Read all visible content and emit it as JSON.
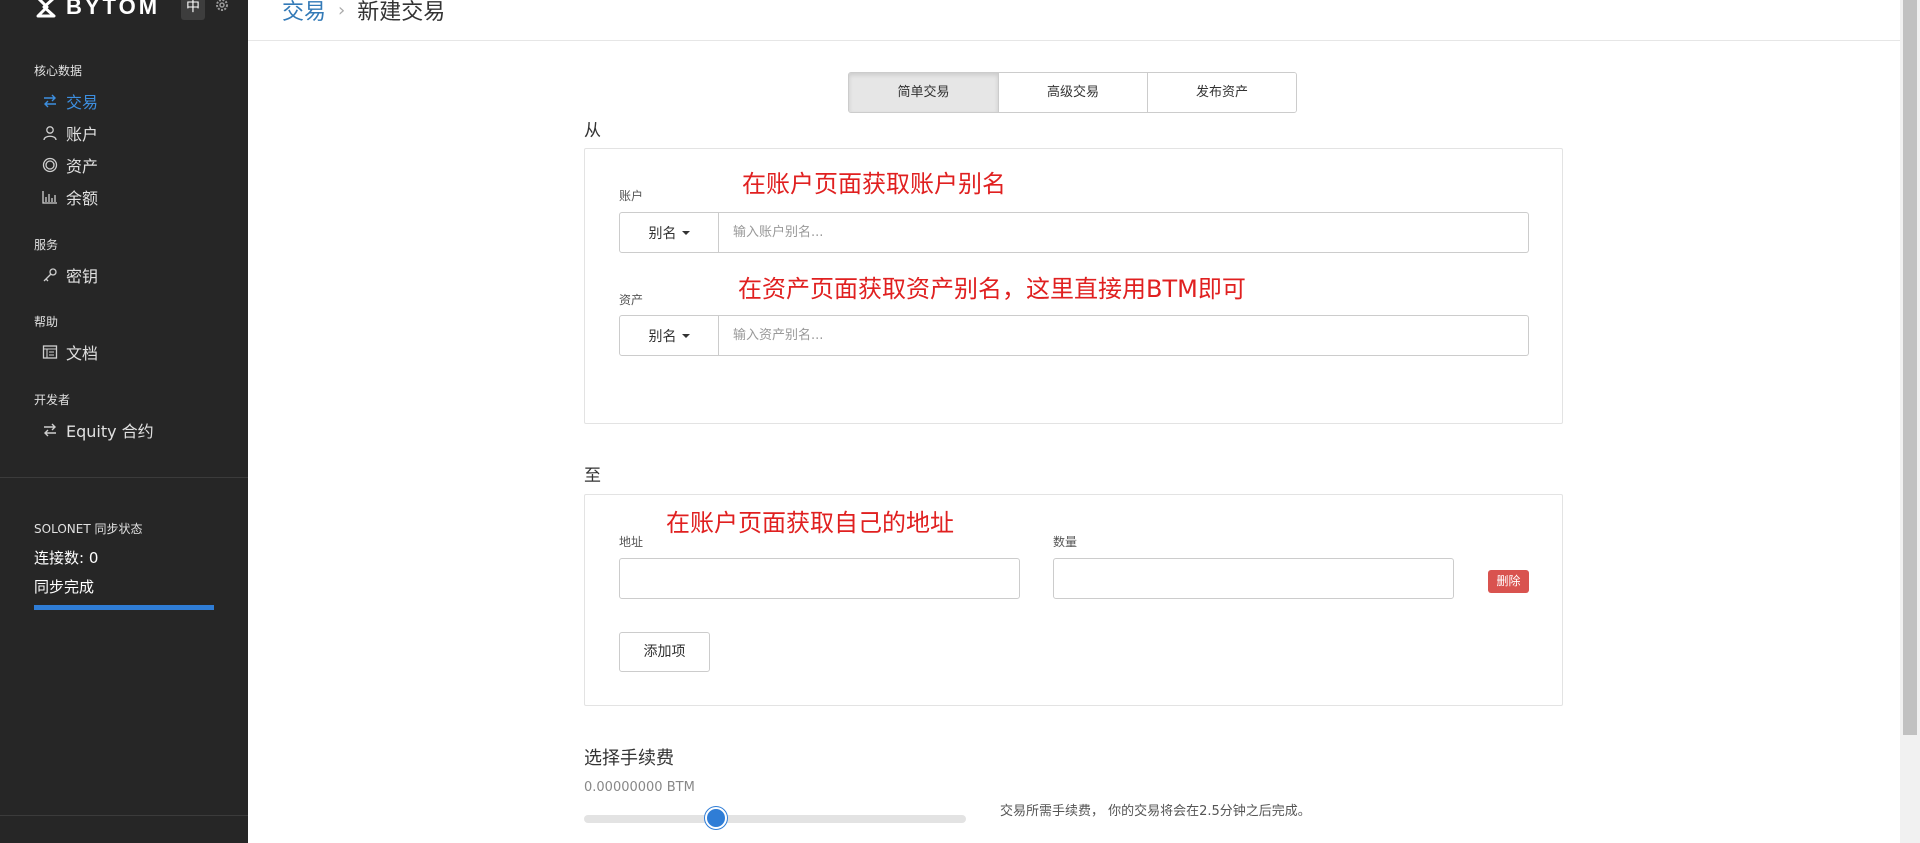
{
  "brand": {
    "name": "BYTOM",
    "lang_button": "中",
    "accent": "#3d8fe0"
  },
  "sidebar": {
    "groups": [
      {
        "title": "核心数据",
        "items": [
          {
            "label": "交易",
            "icon": "transfer-icon",
            "active": true
          },
          {
            "label": "账户",
            "icon": "user-icon"
          },
          {
            "label": "资产",
            "icon": "circle-icon"
          },
          {
            "label": "余额",
            "icon": "bar-chart-icon"
          }
        ]
      },
      {
        "title": "服务",
        "items": [
          {
            "label": "密钥",
            "icon": "key-icon"
          }
        ]
      },
      {
        "title": "帮助",
        "items": [
          {
            "label": "文档",
            "icon": "document-icon"
          }
        ]
      },
      {
        "title": "开发者",
        "items": [
          {
            "label": "Equity 合约",
            "icon": "transfer-icon"
          }
        ]
      }
    ],
    "sync": {
      "title": "SOLONET 同步状态",
      "connections": "连接数: 0",
      "state": "同步完成",
      "progress": 1.0
    }
  },
  "header": {
    "crumb_parent": "交易",
    "crumb_current": "新建交易"
  },
  "tabs": [
    "简单交易",
    "高级交易",
    "发布资产"
  ],
  "from": {
    "label": "从",
    "account": {
      "label": "账户",
      "addon": "别名",
      "placeholder": "输入账户别名..."
    },
    "asset": {
      "label": "资产",
      "addon": "别名",
      "placeholder": "输入资产别名..."
    }
  },
  "to": {
    "label": "至",
    "address_label": "地址",
    "amount_label": "数量",
    "delete_label": "删除",
    "add_label": "添加项"
  },
  "annotations": {
    "account": "在账户页面获取账户别名",
    "asset": "在资产页面获取资产别名，这里直接用BTM即可",
    "address": "在账户页面获取自己的地址",
    "color": "#e02020"
  },
  "fee": {
    "title": "选择手续费",
    "value": "0.00000000 BTM",
    "slider_level": 0.345,
    "note": "交易所需手续费，  你的交易将会在2.5分钟之后完成。"
  }
}
